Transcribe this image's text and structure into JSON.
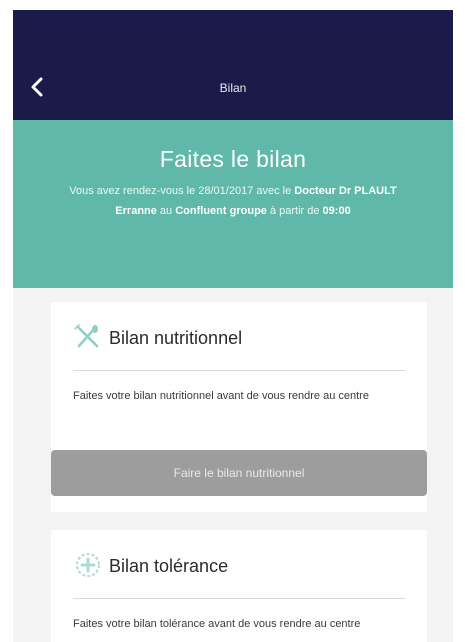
{
  "header": {
    "title": "Bilan",
    "back_icon": "chevron-left-icon",
    "background": "#1b1a48"
  },
  "hero": {
    "title": "Faites le bilan",
    "text_prefix": "Vous avez rendez-vous le 28/01/2017 avec le",
    "doctor": "Docteur Dr PLAULT Erranne",
    "text_mid": " au ",
    "center": "Confluent",
    "group": "groupe",
    "text_suffix": " à partir de ",
    "time": "09:00",
    "background": "#5fb8a8"
  },
  "cards": [
    {
      "icon": "fork-knife-icon",
      "title": "Bilan nutritionnel",
      "description": "Faites votre bilan nutritionnel avant de vous rendre au centre",
      "button_label": "Faire le bilan nutritionnel"
    },
    {
      "icon": "medical-cross-icon",
      "title": "Bilan tolérance",
      "description": "Faites votre bilan tolérance avant de vous rendre au centre"
    }
  ]
}
